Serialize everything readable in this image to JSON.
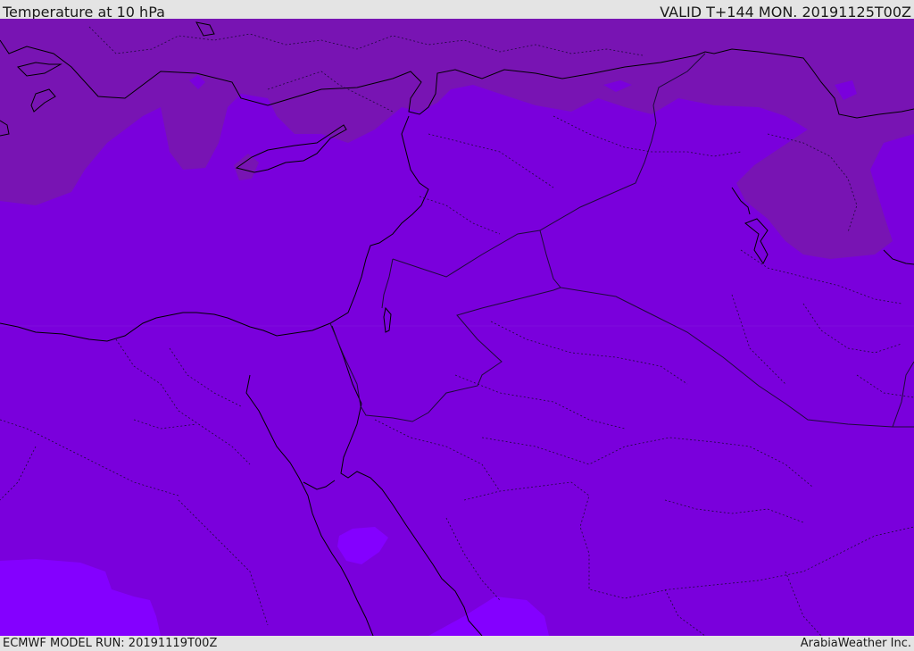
{
  "header": {
    "title": "Temperature at 10 hPa",
    "valid": "VALID T+144 MON. 20191125T00Z"
  },
  "footer": {
    "model_run": "ECMWF MODEL RUN: 20191119T00Z",
    "credit": "ArabiaWeather Inc."
  },
  "map": {
    "colors": {
      "field_main": "#7a00dc",
      "field_warm": "#7814b3",
      "field_cool": "#8400ff",
      "coastline": "#000000",
      "border": "#1e0a3a"
    }
  }
}
